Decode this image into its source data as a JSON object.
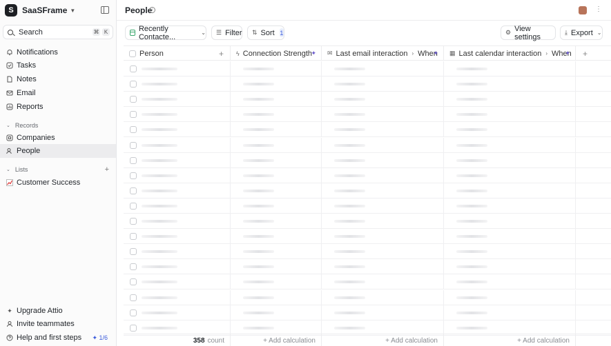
{
  "workspace": {
    "logo": "S",
    "name": "SaaSFrame"
  },
  "search": {
    "label": "Search",
    "keys": [
      "⌘",
      "K"
    ]
  },
  "nav": [
    {
      "label": "Notifications",
      "icon": "bell-icon",
      "glyph": "🔔"
    },
    {
      "label": "Tasks",
      "icon": "checkbox-icon",
      "glyph": "☑"
    },
    {
      "label": "Notes",
      "icon": "note-icon",
      "glyph": "▭"
    },
    {
      "label": "Email",
      "icon": "mail-icon",
      "glyph": "✉"
    },
    {
      "label": "Reports",
      "icon": "report-icon",
      "glyph": "▦"
    }
  ],
  "records": {
    "heading": "Records",
    "items": [
      {
        "label": "Companies",
        "icon": "building-icon",
        "glyph": "▣"
      },
      {
        "label": "People",
        "icon": "people-icon",
        "glyph": "⚇",
        "active": true
      }
    ]
  },
  "lists": {
    "heading": "Lists",
    "items": [
      {
        "label": "Customer Success",
        "icon": "chart-emoji-icon",
        "glyph": "📈"
      }
    ]
  },
  "bottom": [
    {
      "label": "Upgrade Attio",
      "icon": "sparkle-icon",
      "glyph": "✦"
    },
    {
      "label": "Invite teammates",
      "icon": "user-icon",
      "glyph": "♙"
    },
    {
      "label": "Help and first steps",
      "icon": "help-icon",
      "glyph": "?",
      "badge": "✦ 1/6"
    }
  ],
  "page": {
    "title": "People",
    "info": "i"
  },
  "toolbar": {
    "view": "Recently Contacte...",
    "filter": "Filter",
    "sort": "Sort",
    "sort_count": "1",
    "view_settings": "View settings",
    "export": "Export"
  },
  "columns": {
    "person": "Person",
    "strength": "Connection Strength",
    "email": "Last email interaction",
    "email_sub": "When",
    "calendar": "Last calendar interaction",
    "calendar_sub": "When"
  },
  "row_count": 18,
  "footer": {
    "count": "358",
    "count_label": "count",
    "add_calc": "+ Add calculation"
  }
}
